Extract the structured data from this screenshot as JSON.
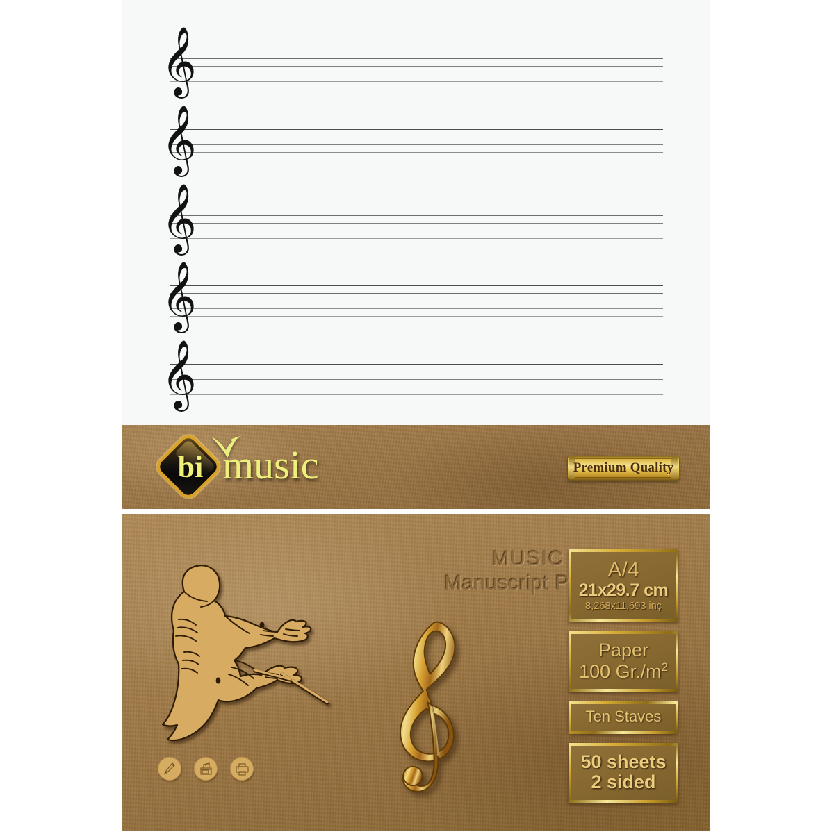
{
  "product": {
    "brand_mark": "bi",
    "brand_word": "music",
    "badge_label": "Premium Quality",
    "cover_title_line1": "MUSIC",
    "cover_title_line2": "Manuscript Paper"
  },
  "staff_sheet": {
    "staves": [
      {
        "clef": "treble-clef",
        "glyph": "𝄞"
      },
      {
        "clef": "treble-clef",
        "glyph": "𝄞"
      },
      {
        "clef": "treble-clef",
        "glyph": "𝄞"
      },
      {
        "clef": "treble-clef",
        "glyph": "𝄞"
      },
      {
        "clef": "treble-clef",
        "glyph": "𝄞"
      }
    ],
    "visible_stave_count": 5,
    "lines_per_stave": 5
  },
  "specs": [
    {
      "id": "size",
      "line1": "A/4",
      "line2": "21x29.7 cm",
      "line3": "8,268x11,693 inç"
    },
    {
      "id": "weight",
      "line1": "Paper",
      "line2": "100 Gr./m",
      "superscript": "2"
    },
    {
      "id": "staves",
      "line1": "Ten Staves"
    },
    {
      "id": "sheets",
      "line1": "50 sheets",
      "line2": "2 sided"
    }
  ],
  "feature_icons": [
    {
      "name": "pencil-icon",
      "label": "Write"
    },
    {
      "name": "copier-icon",
      "label": "Copy"
    },
    {
      "name": "printer-icon",
      "label": "Print"
    }
  ],
  "artwork": {
    "conductor": "conductor-silhouette",
    "clef": "treble-clef-gold"
  },
  "colors": {
    "kraft_light": "#b18b57",
    "kraft_dark": "#87642f",
    "gold": "#e0bb6a",
    "gold_bright": "#f6e28a",
    "brand_yellow": "#eef07e",
    "sheet_white": "#f7f9f8",
    "staff_line": "#6e7376",
    "title_emboss": "#8a6a3e"
  }
}
